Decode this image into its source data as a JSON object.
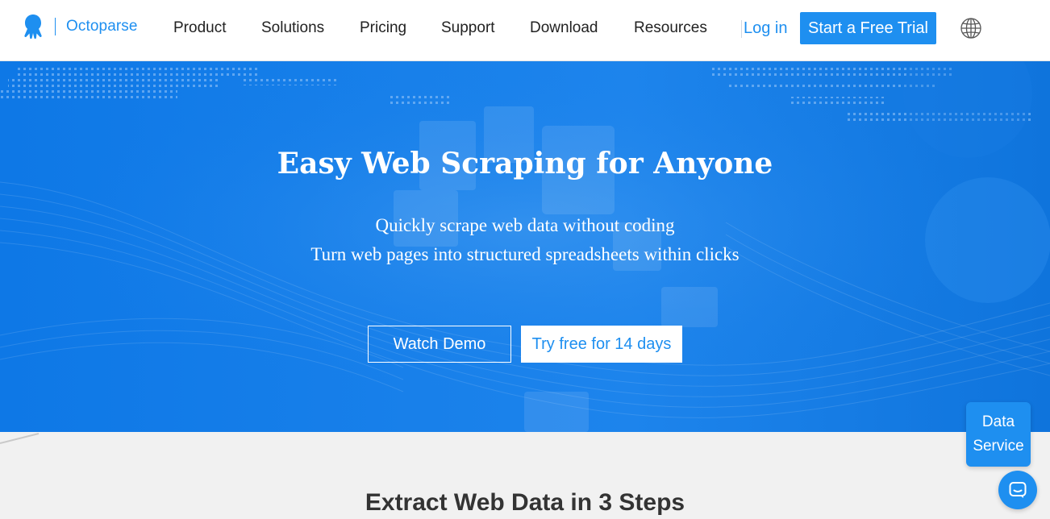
{
  "header": {
    "brand": "Octoparse",
    "nav": [
      {
        "label": "Product"
      },
      {
        "label": "Solutions"
      },
      {
        "label": "Pricing"
      },
      {
        "label": "Support"
      },
      {
        "label": "Download"
      },
      {
        "label": "Resources"
      }
    ],
    "login_label": "Log in",
    "cta_label": "Start a Free Trial",
    "language_icon": "globe-icon"
  },
  "hero": {
    "title": "Easy Web Scraping for Anyone",
    "subtitle_line1": "Quickly scrape web data without coding",
    "subtitle_line2": "Turn web pages into structured spreadsheets within clicks",
    "watch_demo_label": "Watch Demo",
    "try_free_label": "Try free for 14 days"
  },
  "steps": {
    "title": "Extract Web Data in 3 Steps"
  },
  "widgets": {
    "data_service_line1": "Data",
    "data_service_line2": "Service",
    "chat_icon": "chat-icon"
  },
  "colors": {
    "brand_blue": "#1e8ff0",
    "hero_blue": "#1880ea",
    "section_gray": "#f1f1f1"
  }
}
